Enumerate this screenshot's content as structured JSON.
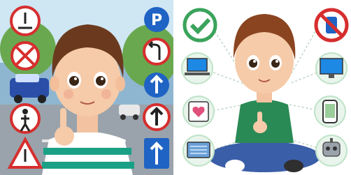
{
  "panels": [
    {
      "id": "traffic-safety",
      "description_icons": [
        "pedestrian-crossing-sign",
        "no-entry-sign",
        "police-car",
        "pedestrian-sign",
        "warning-triangle-sign",
        "parking-sign",
        "no-left-turn-sign",
        "ahead-arrow-sign",
        "ahead-arrow-sign-2",
        "one-way-sign"
      ],
      "colors": {
        "sign_red": "#d62e2e",
        "sign_blue": "#1f63c4",
        "shirt": "#1aa085",
        "hair": "#6b3a1e"
      }
    },
    {
      "id": "device-safety",
      "description_icons": [
        "checkmark-icon",
        "laptop-icon",
        "tablet-heart-icon",
        "keyboard-icon",
        "no-phone-icon",
        "monitor-icon",
        "phone-icon",
        "robot-icon"
      ],
      "colors": {
        "ring_green": "#3aa35c",
        "ring_red": "#d62e2e",
        "shirt": "#2a8a55",
        "pants": "#3b5ea8",
        "hair": "#8a4520"
      }
    }
  ],
  "signs": {
    "parking_letter": "P"
  }
}
